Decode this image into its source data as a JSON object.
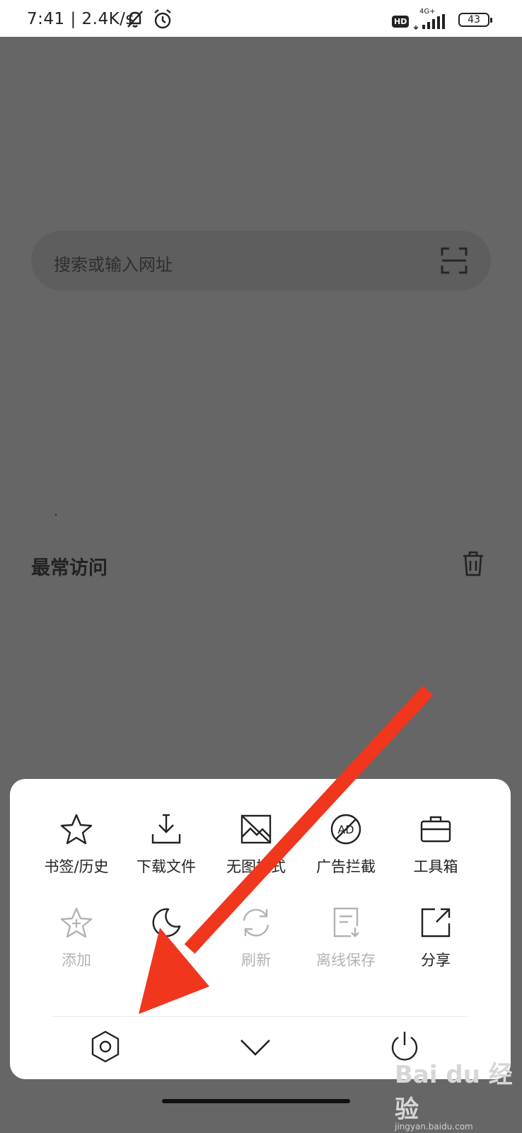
{
  "status_bar": {
    "time_speed": "7:41 | 2.4K/s",
    "hd_label": "HD",
    "network_label": "4G+",
    "battery_level": "43"
  },
  "search": {
    "placeholder": "搜索或输入网址"
  },
  "frequent": {
    "title": "最常访问"
  },
  "menu": {
    "row1": [
      {
        "label": "书签/历史",
        "icon": "star-icon",
        "enabled": true
      },
      {
        "label": "下载文件",
        "icon": "download-icon",
        "enabled": true
      },
      {
        "label": "无图模式",
        "icon": "no-image-icon",
        "enabled": true
      },
      {
        "label": "广告拦截",
        "icon": "ad-block-icon",
        "enabled": true
      },
      {
        "label": "工具箱",
        "icon": "toolbox-icon",
        "enabled": true
      }
    ],
    "row2": [
      {
        "label": "添加",
        "icon": "star-add-icon",
        "enabled": false
      },
      {
        "label": "",
        "icon": "moon-icon",
        "enabled": true
      },
      {
        "label": "刷新",
        "icon": "refresh-icon",
        "enabled": false
      },
      {
        "label": "离线保存",
        "icon": "offline-save-icon",
        "enabled": false
      },
      {
        "label": "分享",
        "icon": "share-icon",
        "enabled": true
      }
    ],
    "bottom": [
      {
        "icon": "settings-icon"
      },
      {
        "icon": "chevron-down-icon"
      },
      {
        "icon": "power-icon"
      }
    ]
  },
  "watermark": {
    "text": "Bai du 经验",
    "subtext": "jingyan.baidu.com"
  },
  "colors": {
    "overlay": "#666666",
    "arrow": "#f0361d",
    "panel": "#ffffff",
    "disabled": "#b3b3b3"
  }
}
